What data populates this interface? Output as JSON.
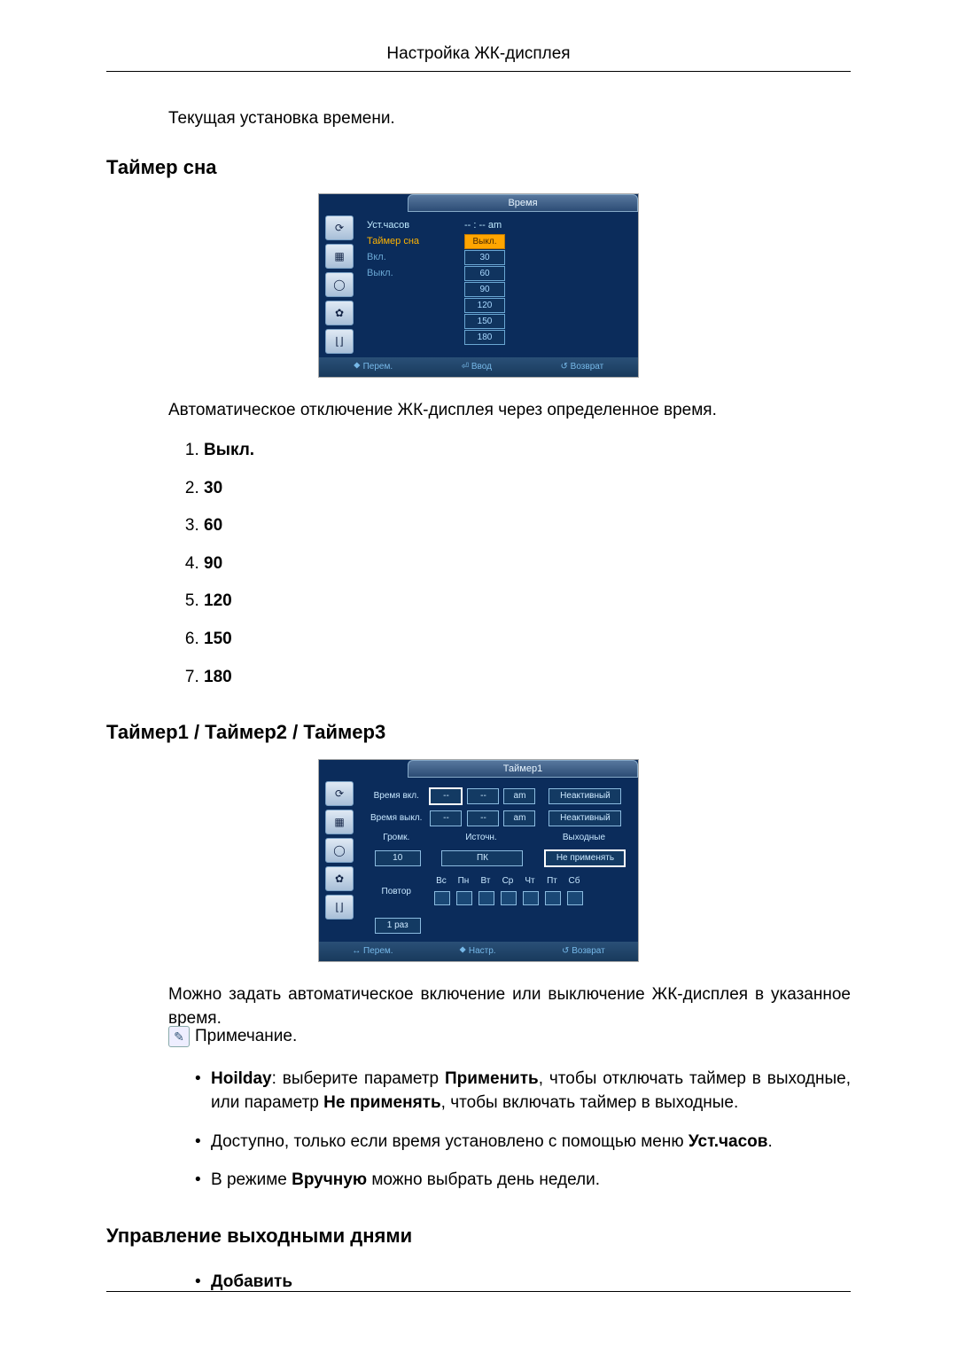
{
  "header": {
    "title": "Настройка ЖК-дисплея"
  },
  "intro_line": "Текущая установка времени.",
  "section_sleep": {
    "heading": "Таймер сна",
    "osd": {
      "title": "Время",
      "menu": {
        "item1": "Уст.часов",
        "item2_sel": "Таймер сна",
        "item3_dim": "Вкл.",
        "item4_dim": "Выкл."
      },
      "clock_value": "-- : -- am",
      "values": [
        "Выкл.",
        "30",
        "60",
        "90",
        "120",
        "150",
        "180"
      ],
      "footer": {
        "a": "⯁ Перем.",
        "b": "⏎ Ввод",
        "c": "↺ Возврат"
      }
    },
    "description": "Автоматическое отключение ЖК-дисплея через определенное время.",
    "options": [
      "Выкл.",
      "30",
      "60",
      "90",
      "120",
      "150",
      "180"
    ]
  },
  "section_timers": {
    "heading": "Таймер1 / Таймер2 / Таймер3",
    "osd": {
      "title": "Таймер1",
      "labels": {
        "on_time": "Время вкл.",
        "off_time": "Время выкл.",
        "volume": "Громк.",
        "source": "Источн.",
        "holiday": "Выходные",
        "repeat": "Повтор",
        "inactive": "Неактивный",
        "vol_val": "10",
        "src_val": "ПК",
        "hol_val": "Не применять",
        "rep_val": "1 раз",
        "dash": "--",
        "am": "am"
      },
      "days": [
        "Вс",
        "Пн",
        "Вт",
        "Ср",
        "Чт",
        "Пт",
        "Сб"
      ],
      "footer": {
        "a": "↔ Перем.",
        "b": "⯁ Настр.",
        "c": "↺ Возврат"
      }
    },
    "description": "Можно задать автоматическое включение или выключение ЖК-дисплея в указанное время.",
    "note_label": "Примечание.",
    "bullets": {
      "b1_pre": "Hoilday",
      "b1_mid1": ": выберите параметр ",
      "b1_apply": "Применить",
      "b1_mid2": ", чтобы отключать таймер в выходные, или параметр ",
      "b1_noapply": "Не применять",
      "b1_tail": ", чтобы включать таймер в выходные.",
      "b2_pre": "Доступно, только если время установлено с помощью меню ",
      "b2_bold": "Уст.часов",
      "b2_tail": ".",
      "b3_pre": "В режиме ",
      "b3_bold": "Вручную",
      "b3_tail": " можно выбрать день недели."
    }
  },
  "section_holiday": {
    "heading": "Управление выходными днями",
    "bullet1": "Добавить"
  },
  "icons": {
    "i1": "⟳",
    "i2": "▦",
    "i3": "◯",
    "i4": "✿",
    "i5": "⌊⌋"
  }
}
